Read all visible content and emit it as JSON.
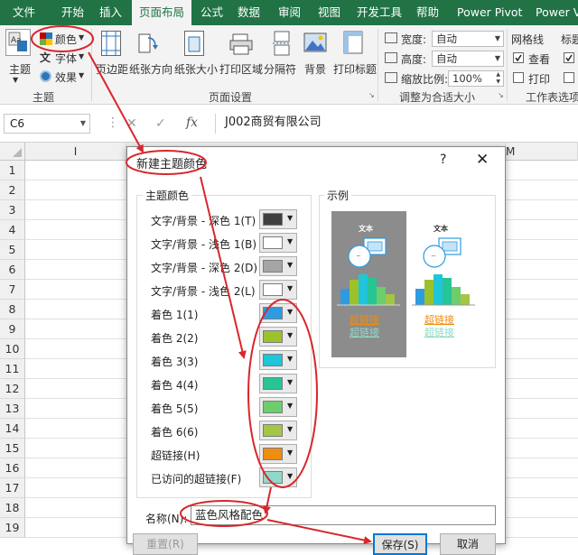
{
  "ribbon_tabs": [
    "文件",
    "开始",
    "插入",
    "页面布局",
    "公式",
    "数据",
    "审阅",
    "视图",
    "开发工具",
    "帮助",
    "Power Pivot",
    "Power V"
  ],
  "ribbon": {
    "theme": "主题",
    "colors": "颜色",
    "fonts": "字体",
    "effects": "效果",
    "themes_group": "主题",
    "margins": "页边距",
    "orientation": "纸张方向",
    "size": "纸张大小",
    "print_area": "打印区域",
    "breaks": "分隔符",
    "background": "背景",
    "print_titles": "打印标题",
    "page_setup_group": "页面设置",
    "width_label": "宽度:",
    "width_value": "自动",
    "height_label": "高度:",
    "height_value": "自动",
    "scale_label": "缩放比例:",
    "scale_value": "100%",
    "scale_group": "调整为合适大小",
    "gridlines": "网格线",
    "headings": "标题",
    "view": "查看",
    "print": "打印",
    "sheet_options_group": "工作表选项"
  },
  "formula_bar": {
    "name_box": "C6",
    "formula": "J002商贸有限公司"
  },
  "grid": {
    "columns": [
      "I",
      "M"
    ],
    "rows": [
      "1",
      "2",
      "3",
      "4",
      "5",
      "6",
      "7",
      "8",
      "9",
      "10",
      "11",
      "12",
      "13",
      "14",
      "15",
      "16",
      "17",
      "18",
      "19"
    ]
  },
  "dialog": {
    "title": "新建主题颜色",
    "help": "?",
    "close": "✕",
    "theme_colors_label": "主题颜色",
    "preview_label": "示例",
    "items": [
      {
        "label": "文字/背景 - 深色 1(T)",
        "color": "#404040"
      },
      {
        "label": "文字/背景 - 浅色 1(B)",
        "color": "#ffffff"
      },
      {
        "label": "文字/背景 - 深色 2(D)",
        "color": "#a5a5a5"
      },
      {
        "label": "文字/背景 - 浅色 2(L)",
        "color": "#ffffff"
      },
      {
        "label": "着色 1(1)",
        "color": "#2e9be0"
      },
      {
        "label": "着色 2(2)",
        "color": "#9bc22b"
      },
      {
        "label": "着色 3(3)",
        "color": "#1fc5d9"
      },
      {
        "label": "着色 4(4)",
        "color": "#27c495"
      },
      {
        "label": "着色 5(5)",
        "color": "#6ccd6d"
      },
      {
        "label": "着色 6(6)",
        "color": "#a5c544"
      },
      {
        "label": "超链接(H)",
        "color": "#ef8c12"
      },
      {
        "label": "已访问的超链接(F)",
        "color": "#8ed9c8"
      }
    ],
    "preview": {
      "text": "文本",
      "hyperlink": "超链接",
      "visited": "超链接",
      "dark_bg": "#8c8c8c",
      "bar_colors": [
        "#2e9be0",
        "#9bc22b",
        "#1fc5d9",
        "#27c495",
        "#6ccd6d",
        "#a5c544"
      ]
    },
    "name_label": "名称(N):",
    "name_value": "蓝色风格配色",
    "reset_button": "重置(R)",
    "save_button": "保存(S)",
    "cancel_button": "取消"
  },
  "annotation_color": "#d9262c"
}
